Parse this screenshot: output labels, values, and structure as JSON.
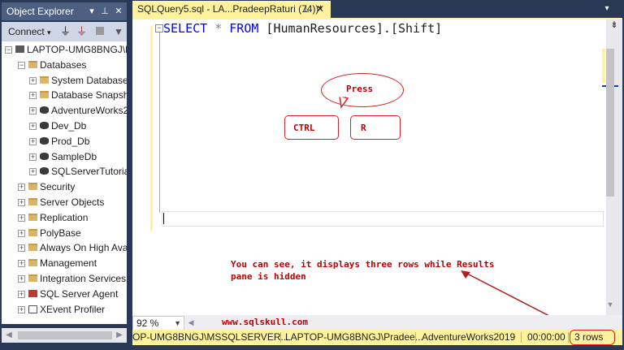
{
  "object_explorer": {
    "title": "Object Explorer",
    "title_icons": [
      "dropdown-icon",
      "pin-icon",
      "close-icon"
    ],
    "toolbar": {
      "connect_label": "Connect",
      "buttons": [
        "connect-dropdown-icon",
        "connect-plug-icon",
        "disconnect-icon",
        "stop-icon",
        "filter-icon"
      ]
    },
    "tree": [
      {
        "label": "LAPTOP-UMG8BNGJ\\M",
        "icon": "server-icon",
        "expander": "−",
        "level": 0
      },
      {
        "label": "Databases",
        "icon": "folder-icon",
        "expander": "−",
        "level": 1
      },
      {
        "label": "System Databases",
        "icon": "folder-icon",
        "expander": "+",
        "level": 2
      },
      {
        "label": "Database Snapsho",
        "icon": "folder-icon",
        "expander": "+",
        "level": 2
      },
      {
        "label": "AdventureWorks2",
        "icon": "database-icon",
        "expander": "+",
        "level": 2
      },
      {
        "label": "Dev_Db",
        "icon": "database-icon",
        "expander": "+",
        "level": 2
      },
      {
        "label": "Prod_Db",
        "icon": "database-icon",
        "expander": "+",
        "level": 2
      },
      {
        "label": "SampleDb",
        "icon": "database-icon",
        "expander": "+",
        "level": 2
      },
      {
        "label": "SQLServerTutorials",
        "icon": "database-icon",
        "expander": "+",
        "level": 2
      },
      {
        "label": "Security",
        "icon": "folder-icon",
        "expander": "+",
        "level": 1
      },
      {
        "label": "Server Objects",
        "icon": "folder-icon",
        "expander": "+",
        "level": 1
      },
      {
        "label": "Replication",
        "icon": "folder-icon",
        "expander": "+",
        "level": 1
      },
      {
        "label": "PolyBase",
        "icon": "folder-icon",
        "expander": "+",
        "level": 1
      },
      {
        "label": "Always On High Ava",
        "icon": "folder-icon",
        "expander": "+",
        "level": 1
      },
      {
        "label": "Management",
        "icon": "folder-icon",
        "expander": "+",
        "level": 1
      },
      {
        "label": "Integration Services (",
        "icon": "folder-icon",
        "expander": "+",
        "level": 1
      },
      {
        "label": "SQL Server Agent",
        "icon": "agent-icon",
        "expander": "+",
        "level": 1
      },
      {
        "label": "XEvent Profiler",
        "icon": "xevent-icon",
        "expander": "+",
        "level": 1
      }
    ]
  },
  "document_tab": {
    "title": "SQLQuery5.sql - LA...PradeepRaturi (74))*",
    "pin_icon": "pin-icon",
    "close_icon": "close-icon"
  },
  "editor": {
    "code": {
      "keyword1": "SELECT",
      "star": " * ",
      "keyword2": "FROM",
      "object": " [HumanResources].[Shift]"
    },
    "collapse_glyph": "−"
  },
  "annotations": {
    "bubble_text": "Press",
    "key1": "CTRL",
    "key2": "R",
    "note_line1": "You can see, it displays three rows while Results",
    "note_line2": "pane is hidden",
    "watermark": "www.sqlskull.com",
    "highlight_color": "#d92020"
  },
  "zoom": {
    "value": "92 %"
  },
  "status_bar": {
    "server": "OP-UMG8BNGJ\\MSSQLSERVER...",
    "user": "LAPTOP-UMG8BNGJ\\Pradee...",
    "database": "AdventureWorks2019",
    "elapsed": "00:00:00",
    "rows": "3 rows",
    "background": "#fff29d"
  },
  "theme": {
    "chrome": "#293955",
    "tab_active": "#fff29d",
    "keyword": "#0000ff"
  }
}
